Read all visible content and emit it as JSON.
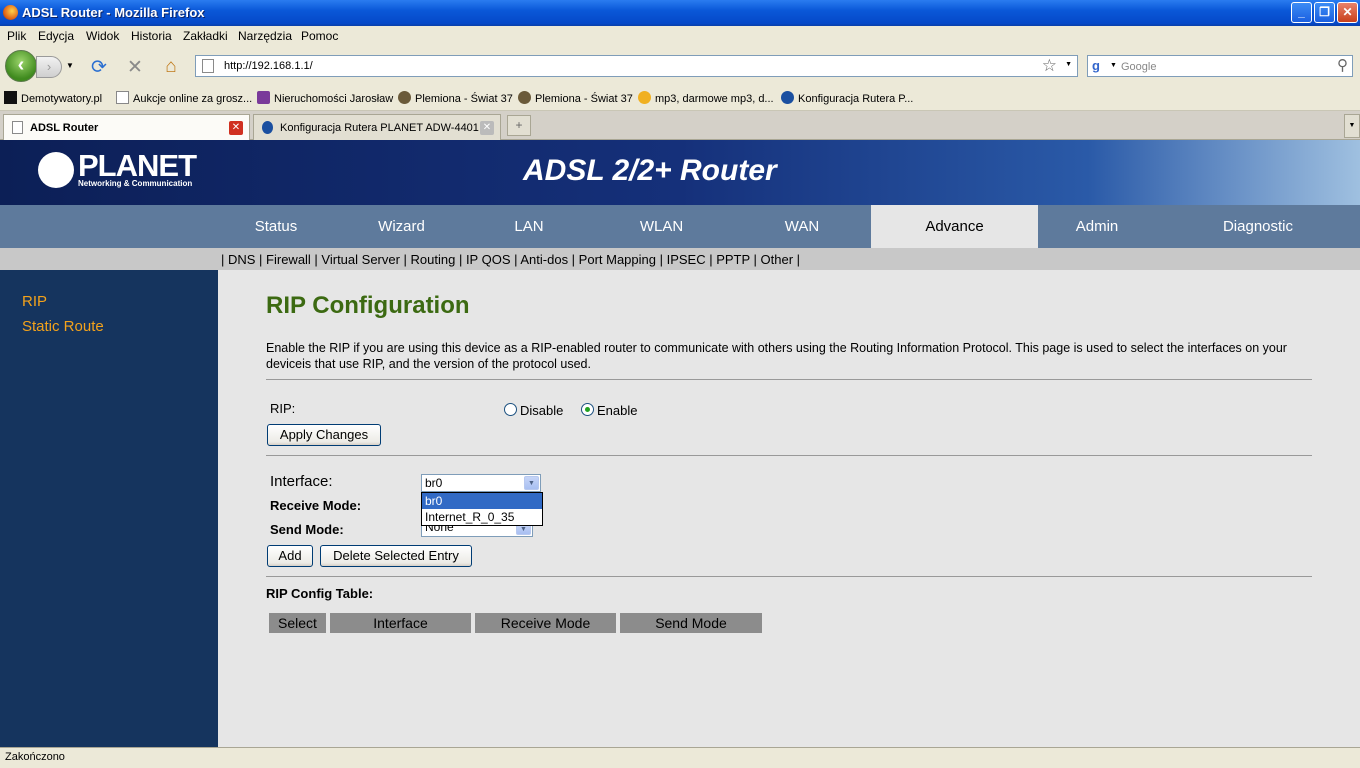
{
  "window": {
    "title": "ADSL Router - Mozilla Firefox",
    "minimize": "_",
    "maximize": "❐",
    "close": "✕"
  },
  "menu": [
    "Plik",
    "Edycja",
    "Widok",
    "Historia",
    "Zakładki",
    "Narzędzia",
    "Pomoc"
  ],
  "toolbar": {
    "back": "‹",
    "forward": "›",
    "reload": "⟳",
    "stop": "✕",
    "home": "⌂",
    "url": "http://192.168.1.1/",
    "search_engine": "g",
    "search_placeholder": "Google"
  },
  "bookmarks": [
    "Demotywatory.pl",
    "Aukcje online za grosz...",
    "Nieruchomości Jarosław",
    "Plemiona - Świat 37",
    "Plemiona - Świat 37",
    "mp3, darmowe mp3, d...",
    "Konfiguracja Rutera P..."
  ],
  "tabs": [
    {
      "label": "ADSL Router"
    },
    {
      "label": "Konfiguracja Rutera PLANET ADW-4401"
    }
  ],
  "router": {
    "logo": "PLANET",
    "logo_sub": "Networking & Communication",
    "product": "ADSL 2/2+ Router",
    "nav": [
      "Status",
      "Wizard",
      "LAN",
      "WLAN",
      "WAN",
      "Advance",
      "Admin",
      "Diagnostic"
    ],
    "subnav": "| DNS | Firewall | Virtual Server | Routing | IP QOS | Anti-dos | Port Mapping | IPSEC | PPTP | Other |",
    "sidebar": [
      "RIP",
      "Static Route"
    ]
  },
  "rip": {
    "title": "RIP Configuration",
    "description": "Enable the RIP if you are using this device as a RIP-enabled router to communicate with others using the Routing Information Protocol. This page is used to select the interfaces on your deviceis that use RIP, and the version of the protocol used.",
    "rip_label": "RIP:",
    "disable_label": "Disable",
    "enable_label": "Enable",
    "apply_button": "Apply Changes",
    "interface_label": "Interface:",
    "interface_value": "br0",
    "interface_options": [
      "br0",
      "Internet_R_0_35"
    ],
    "receive_mode_label": "Receive Mode:",
    "send_mode_label": "Send Mode:",
    "send_mode_value": "None",
    "add_button": "Add",
    "delete_button": "Delete Selected Entry",
    "table_title": "RIP Config Table:",
    "table_headers": [
      "Select",
      "Interface",
      "Receive Mode",
      "Send Mode"
    ]
  },
  "status": "Zakończono"
}
